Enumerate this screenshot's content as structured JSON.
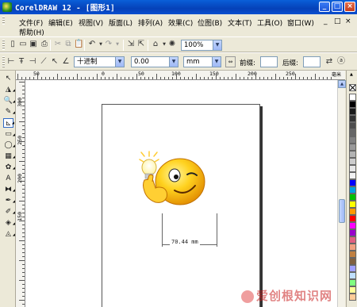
{
  "window": {
    "title": "CorelDRAW 12 - [图形1]",
    "buttons": [
      "_",
      "□",
      "×"
    ]
  },
  "menu": {
    "items": [
      "文件(F)",
      "编辑(E)",
      "视图(V)",
      "版面(L)",
      "排列(A)",
      "效果(C)",
      "位图(B)",
      "文本(T)",
      "工具(O)",
      "窗口(W)"
    ],
    "help": "帮助(H)",
    "doc_buttons": [
      "_",
      "□",
      "×"
    ]
  },
  "standard_toolbar": {
    "zoom": "100%"
  },
  "property_bar": {
    "units_format": "十进制",
    "precision": "0.00",
    "unit": "mm",
    "prefix_label": "前缀:",
    "suffix_label": "后缀:"
  },
  "rulers": {
    "unit_label": "毫米",
    "h_numbers": [
      "50",
      "0",
      "50",
      "100",
      "150",
      "200",
      "250"
    ],
    "v_numbers": [
      "300",
      "250",
      "200",
      "150"
    ]
  },
  "canvas": {
    "dimension_text": "70.44 mm"
  },
  "palette": {
    "colors": [
      "#ffffff",
      "#000000",
      "#1a1a1a",
      "#333333",
      "#4d4d4d",
      "#666666",
      "#808080",
      "#999999",
      "#b3b3b3",
      "#cccccc",
      "#e6e6e6",
      "#f2f2f2",
      "#0000ff",
      "#00a0e0",
      "#00c000",
      "#ffff00",
      "#ff9900",
      "#ff0000",
      "#ff00ff",
      "#9900cc",
      "#e06080",
      "#f0a080",
      "#c08040",
      "#806040",
      "#a0a0ff",
      "#c0e0ff",
      "#80ff80",
      "#ffff99",
      "#ffcc99"
    ]
  },
  "watermark": {
    "text": "爱创根知识网"
  }
}
